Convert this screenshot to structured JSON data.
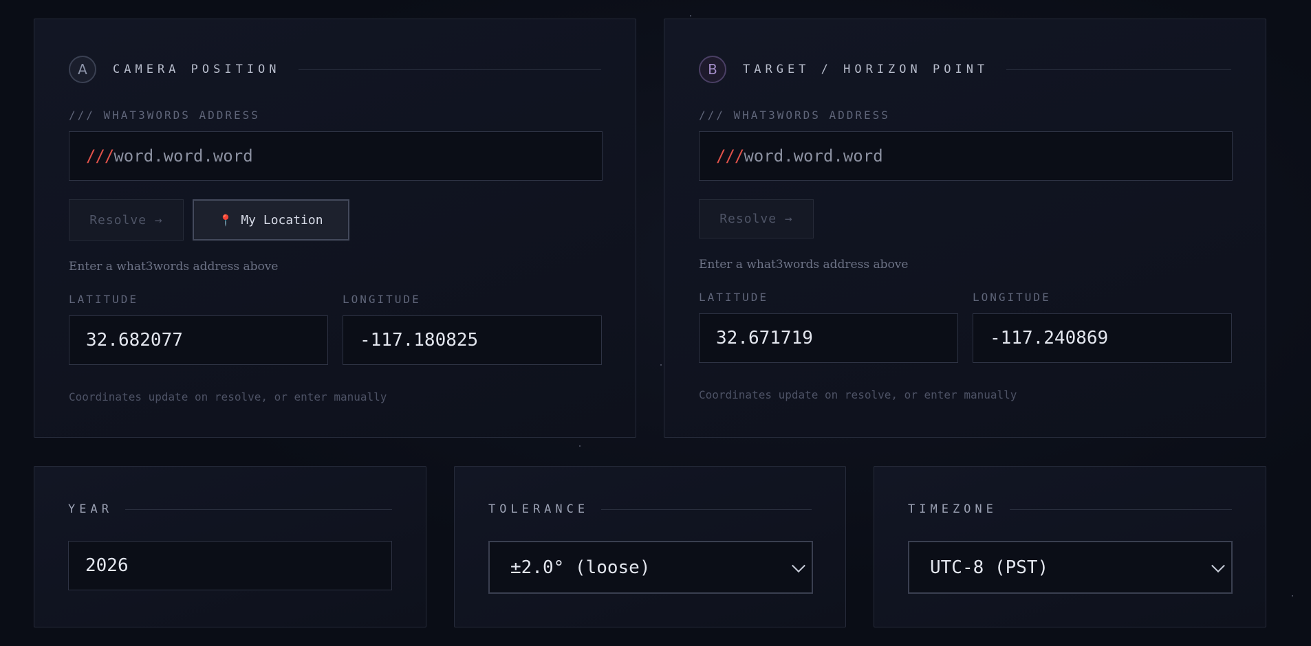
{
  "camera": {
    "badge": "A",
    "title": "CAMERA POSITION",
    "w3w_label": "/// WHAT3WORDS ADDRESS",
    "w3w_prefix": "///",
    "w3w_placeholder": "word.word.word",
    "resolve_label": "Resolve →",
    "location_icon": "pin-icon",
    "location_glyph": "📍",
    "location_label": "My Location",
    "hint": "Enter a what3words address above",
    "lat_label": "LATITUDE",
    "lat_value": "32.682077",
    "lon_label": "LONGITUDE",
    "lon_value": "-117.180825",
    "footnote": "Coordinates update on resolve, or enter manually"
  },
  "target": {
    "badge": "B",
    "title": "TARGET / HORIZON POINT",
    "w3w_label": "/// WHAT3WORDS ADDRESS",
    "w3w_prefix": "///",
    "w3w_placeholder": "word.word.word",
    "resolve_label": "Resolve →",
    "hint": "Enter a what3words address above",
    "lat_label": "LATITUDE",
    "lat_value": "32.671719",
    "lon_label": "LONGITUDE",
    "lon_value": "-117.240869",
    "footnote": "Coordinates update on resolve, or enter manually"
  },
  "year": {
    "title": "YEAR",
    "value": "2026"
  },
  "tolerance": {
    "title": "TOLERANCE",
    "value": "±2.0° (loose)"
  },
  "timezone": {
    "title": "TIMEZONE",
    "value": "UTC-8 (PST)"
  },
  "colors": {
    "accent_slashes": "#e0524a",
    "badge_b": "#a38dc8"
  }
}
